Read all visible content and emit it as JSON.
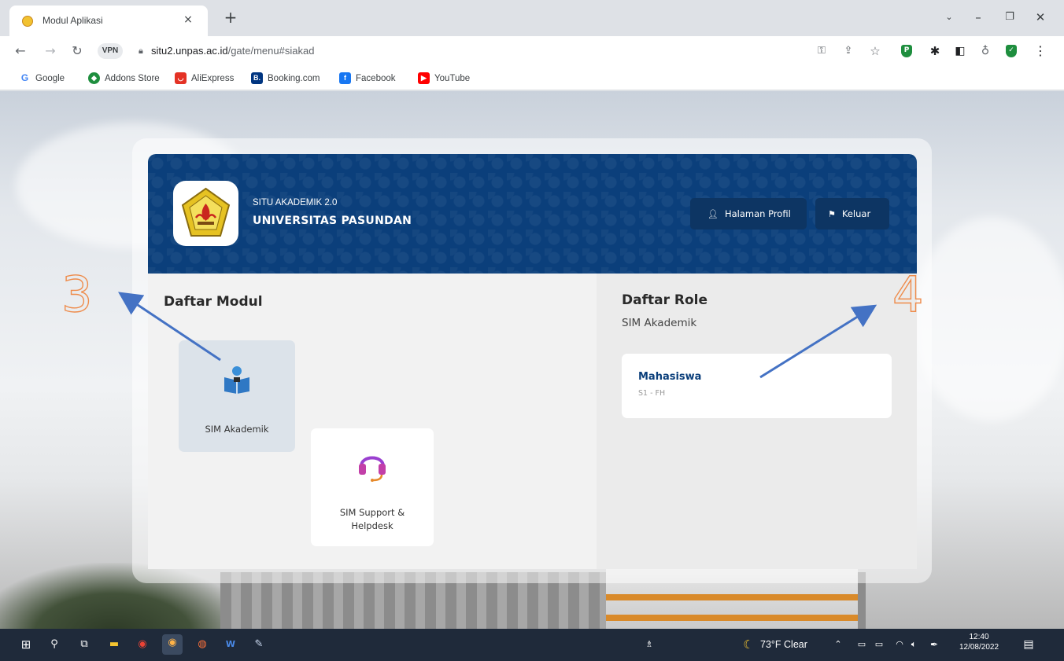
{
  "browser": {
    "tab_title": "Modul Aplikasi",
    "tab_close": "×",
    "new_tab": "+",
    "vpn_label": "VPN",
    "url_host": "situ2.unpas.ac.id",
    "url_path": "/gate/menu#siakad",
    "bookmarks": [
      {
        "label": "Google",
        "icon": "google-icon",
        "color": "#4285f4"
      },
      {
        "label": "Addons Store",
        "icon": "addons-store-icon",
        "color": "#1e8e3e"
      },
      {
        "label": "AliExpress",
        "icon": "aliexpress-icon",
        "color": "#e43225"
      },
      {
        "label": "Booking.com",
        "icon": "booking-icon",
        "color": "#003580"
      },
      {
        "label": "Facebook",
        "icon": "facebook-icon",
        "color": "#1877f2"
      },
      {
        "label": "YouTube",
        "icon": "youtube-icon",
        "color": "#ff0000"
      }
    ]
  },
  "header": {
    "subtitle": "SITU AKADEMIK 2.0",
    "title": "UNIVERSITAS PASUNDAN",
    "profile_button": "Halaman Profil",
    "logout_button": "Keluar",
    "color": "#0b3f7b"
  },
  "modules": {
    "title": "Daftar Modul",
    "items": [
      {
        "label": "SIM Akademik",
        "icon": "student-reading-icon",
        "active": true
      },
      {
        "label": "SIM Support & Helpdesk",
        "icon": "headset-icon",
        "active": false
      }
    ]
  },
  "roles": {
    "title": "Daftar Role",
    "subtitle": "SIM Akademik",
    "items": [
      {
        "name": "Mahasiswa",
        "detail": "S1 - FH"
      }
    ]
  },
  "annotations": [
    "3",
    "4"
  ],
  "taskbar": {
    "weather": "73°F Clear",
    "time": "12:40",
    "date": "12/08/2022"
  }
}
